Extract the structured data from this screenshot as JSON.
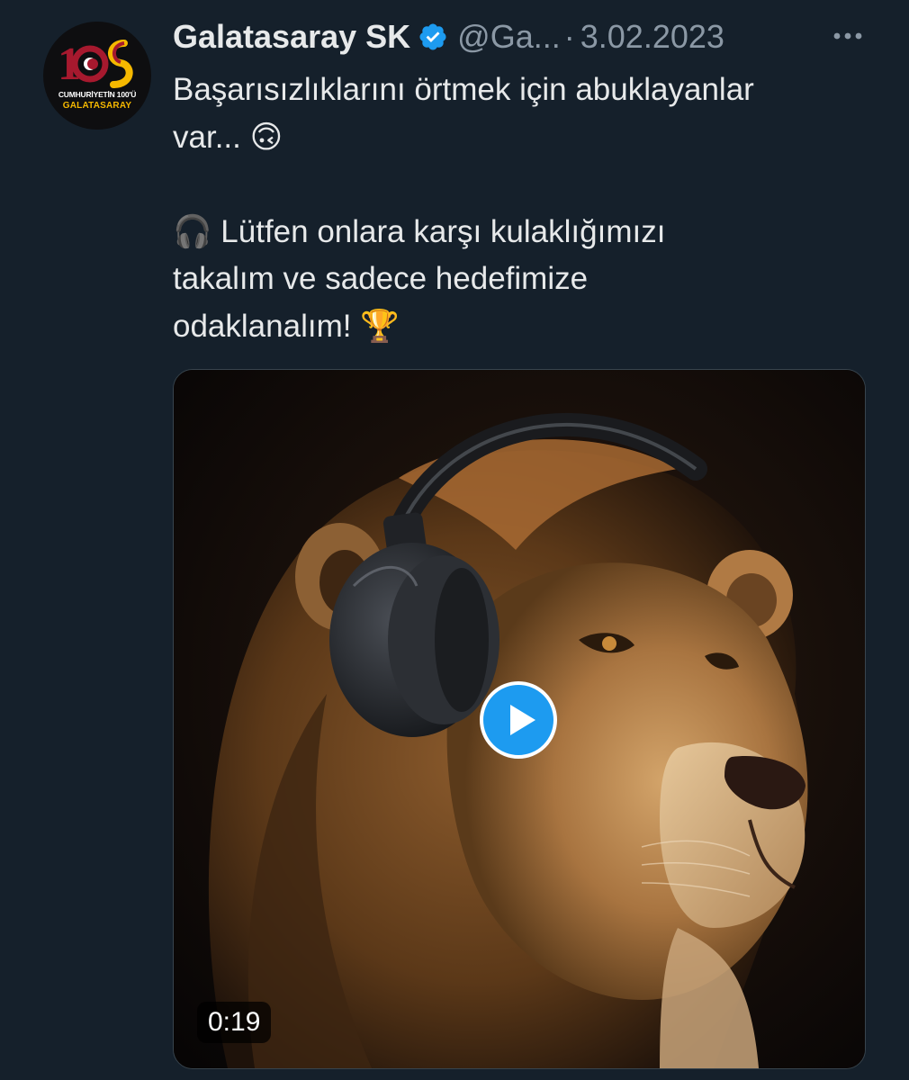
{
  "tweet": {
    "author": {
      "display_name": "Galatasaray SK",
      "handle": "@Ga...",
      "avatar_line1": "CUMHURİYETİN 100'Ü",
      "avatar_line2": "GALATASARAY",
      "verified": true
    },
    "separator": "·",
    "timestamp": "3.02.2023",
    "text_lines": {
      "p1": "Başarısızlıklarını örtmek için abuklayanlar\nvar... 🙃",
      "p2": "🎧 Lütfen onlara karşı kulaklığımızı\ntakalım ve sadece hedefimize\nodaklanalım! 🏆"
    },
    "media": {
      "type": "video",
      "duration": "0:19"
    }
  },
  "colors": {
    "background": "#15202b",
    "text_primary": "#e7e9ea",
    "text_secondary": "#8b98a5",
    "accent": "#1d9bf0",
    "badge_bg": "#000000"
  },
  "icons": {
    "verified": "verified-badge-icon",
    "more": "more-horizontal-icon",
    "play": "play-icon"
  }
}
